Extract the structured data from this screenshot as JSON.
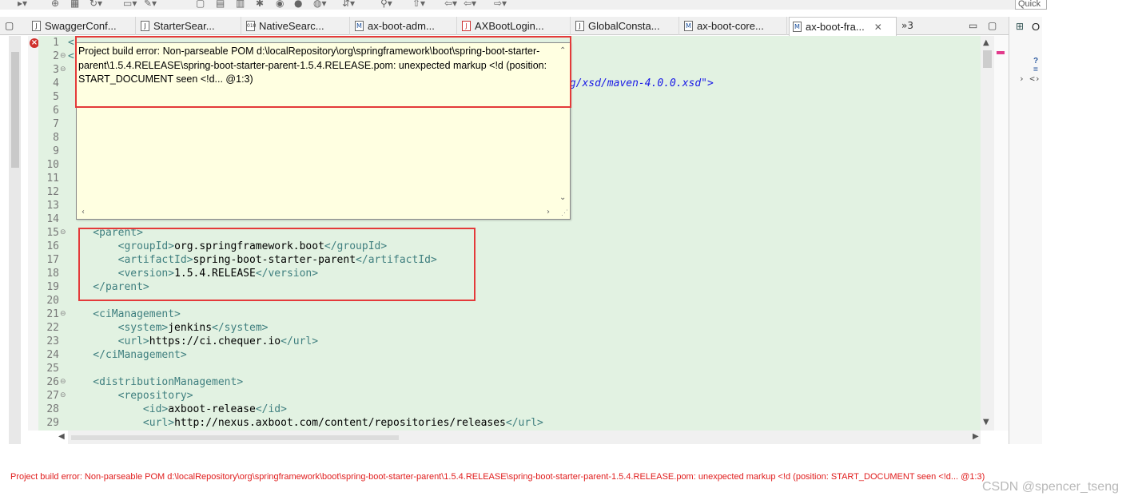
{
  "toolbar": {
    "quick_access_label": "Quick"
  },
  "editor_tabs": [
    {
      "label": "SwaggerConf...",
      "icon": "J"
    },
    {
      "label": "StarterSear...",
      "icon": "J"
    },
    {
      "label": "NativeSearc...",
      "icon": "010"
    },
    {
      "label": "ax-boot-adm...",
      "icon": "M"
    },
    {
      "label": "AXBootLogin...",
      "icon": "J"
    },
    {
      "label": "GlobalConsta...",
      "icon": "J"
    },
    {
      "label": "ax-boot-core...",
      "icon": "M"
    },
    {
      "label": "ax-boot-fra...",
      "icon": "M",
      "active": true,
      "close": "✕"
    }
  ],
  "tab_overflow": "»3",
  "outline_view": {
    "title": "O",
    "small_label": "?=",
    "node_label": "› <›"
  },
  "hover_popup": {
    "message": "Project build error: Non-parseable POM d:\\localRepository\\org\\springframework\\boot\\spring-boot-starter-parent\\1.5.4.RELEASE\\spring-boot-starter-parent-1.5.4.RELEASE.pom: unexpected markup <!d (position: START_DOCUMENT seen <!d... @1:3)"
  },
  "code": {
    "line1_peek": "<",
    "line2_peek": "<",
    "line4_tail": "rg/xsd/maven-4.0.0.xsd\">",
    "lines": [
      {
        "n": "15",
        "fold": "⊖",
        "parts": [
          [
            "tag",
            "    <parent>"
          ]
        ]
      },
      {
        "n": "16",
        "parts": [
          [
            "tag",
            "        <groupId>"
          ],
          [
            "txt",
            "org.springframework.boot"
          ],
          [
            "tag",
            "</groupId>"
          ]
        ]
      },
      {
        "n": "17",
        "parts": [
          [
            "tag",
            "        <artifactId>"
          ],
          [
            "txt",
            "spring-boot-starter-parent"
          ],
          [
            "tag",
            "</artifactId>"
          ]
        ]
      },
      {
        "n": "18",
        "parts": [
          [
            "tag",
            "        <version>"
          ],
          [
            "txt",
            "1.5.4.RELEASE"
          ],
          [
            "tag",
            "</version>"
          ]
        ]
      },
      {
        "n": "19",
        "parts": [
          [
            "tag",
            "    </parent>"
          ]
        ]
      },
      {
        "n": "20",
        "parts": []
      },
      {
        "n": "21",
        "fold": "⊖",
        "parts": [
          [
            "tag",
            "    <ciManagement>"
          ]
        ]
      },
      {
        "n": "22",
        "parts": [
          [
            "tag",
            "        <system>"
          ],
          [
            "txt",
            "jenkins"
          ],
          [
            "tag",
            "</system>"
          ]
        ]
      },
      {
        "n": "23",
        "parts": [
          [
            "tag",
            "        <url>"
          ],
          [
            "txt",
            "https://ci.chequer.io"
          ],
          [
            "tag",
            "</url>"
          ]
        ]
      },
      {
        "n": "24",
        "parts": [
          [
            "tag",
            "    </ciManagement>"
          ]
        ]
      },
      {
        "n": "25",
        "parts": []
      },
      {
        "n": "26",
        "fold": "⊖",
        "parts": [
          [
            "tag",
            "    <distributionManagement>"
          ]
        ]
      },
      {
        "n": "27",
        "fold": "⊖",
        "parts": [
          [
            "tag",
            "        <repository>"
          ]
        ]
      },
      {
        "n": "28",
        "parts": [
          [
            "tag",
            "            <id>"
          ],
          [
            "txt",
            "axboot-release"
          ],
          [
            "tag",
            "</id>"
          ]
        ]
      },
      {
        "n": "29",
        "parts": [
          [
            "tag",
            "            <url>"
          ],
          [
            "txt",
            "http://nexus.axboot.com/content/repositories/releases"
          ],
          [
            "tag",
            "</url>"
          ]
        ]
      }
    ],
    "hidden_line_numbers": [
      "1",
      "2",
      "3",
      "4",
      "5",
      "6",
      "7",
      "8",
      "9",
      "10",
      "11",
      "12",
      "13",
      "14"
    ]
  },
  "status_message": "Project build error: Non-parseable POM d:\\localRepository\\org\\springframework\\boot\\spring-boot-starter-parent\\1.5.4.RELEASE\\spring-boot-starter-parent-1.5.4.RELEASE.pom: unexpected markup <!d (position: START_DOCUMENT seen <!d... @1:3)",
  "watermark": "CSDN @spencer_tseng",
  "colors": {
    "editor_bg": "#e2f2e2",
    "hover_bg": "#ffffe1",
    "highlight_box": "#e43a3a",
    "error_text": "#e01c1c",
    "tag": "#3f7f7f"
  }
}
